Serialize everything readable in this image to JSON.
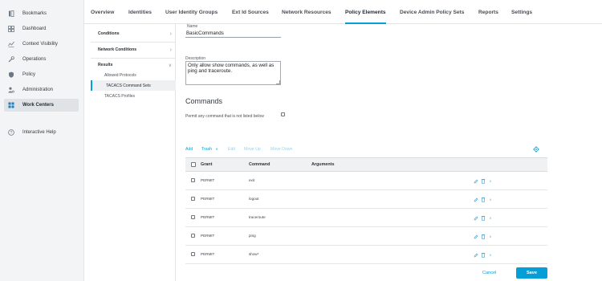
{
  "left_nav": {
    "items": [
      {
        "label": "Bookmarks",
        "icon": "bookmark-icon"
      },
      {
        "label": "Dashboard",
        "icon": "dashboard-icon"
      },
      {
        "label": "Context Visibility",
        "icon": "context-visibility-icon"
      },
      {
        "label": "Operations",
        "icon": "operations-icon"
      },
      {
        "label": "Policy",
        "icon": "policy-icon"
      },
      {
        "label": "Administration",
        "icon": "administration-icon"
      },
      {
        "label": "Work Centers",
        "icon": "work-centers-icon"
      },
      {
        "label": "Interactive Help",
        "icon": "help-icon"
      }
    ],
    "active": "Work Centers"
  },
  "top_nav": {
    "tabs": [
      "Overview",
      "Identities",
      "User Identity Groups",
      "Ext Id Sources",
      "Network Resources",
      "Policy Elements",
      "Device Admin Policy Sets",
      "Reports",
      "Settings"
    ],
    "active": "Policy Elements"
  },
  "sub_nav": {
    "conditions": "Conditions",
    "network_conditions": "Network Conditions",
    "results": "Results",
    "results_items": [
      "Allowed Protocols",
      "TACACS Command Sets",
      "TACACS Profiles"
    ],
    "active": "TACACS Command Sets"
  },
  "form": {
    "name_label": "Name",
    "name_value": "BasicCommands",
    "description_label": "Description",
    "description_value": "Only allow show commands, as well as ping and traceroute.",
    "commands_title": "Commands",
    "permit_label": "Permit any command that is not listed below",
    "permit_checked": false
  },
  "toolbar": {
    "add": "Add",
    "trash": "Trash",
    "trash_chevron": "∨",
    "edit": "Edit",
    "move_up": "Move Up",
    "move_down": "Move Down"
  },
  "table": {
    "columns": [
      "Grant",
      "Command",
      "Arguments"
    ],
    "rows": [
      {
        "grant": "PERMIT",
        "command": "exit",
        "arguments": ""
      },
      {
        "grant": "PERMIT",
        "command": "logout",
        "arguments": ""
      },
      {
        "grant": "PERMIT",
        "command": "traceroute",
        "arguments": ""
      },
      {
        "grant": "PERMIT",
        "command": "ping",
        "arguments": ""
      },
      {
        "grant": "PERMIT",
        "command": "show*",
        "arguments": ""
      }
    ]
  },
  "footer": {
    "cancel": "Cancel",
    "save": "Save"
  },
  "colors": {
    "accent": "#049fd9",
    "sidebar_bg": "#f3f4f5"
  }
}
